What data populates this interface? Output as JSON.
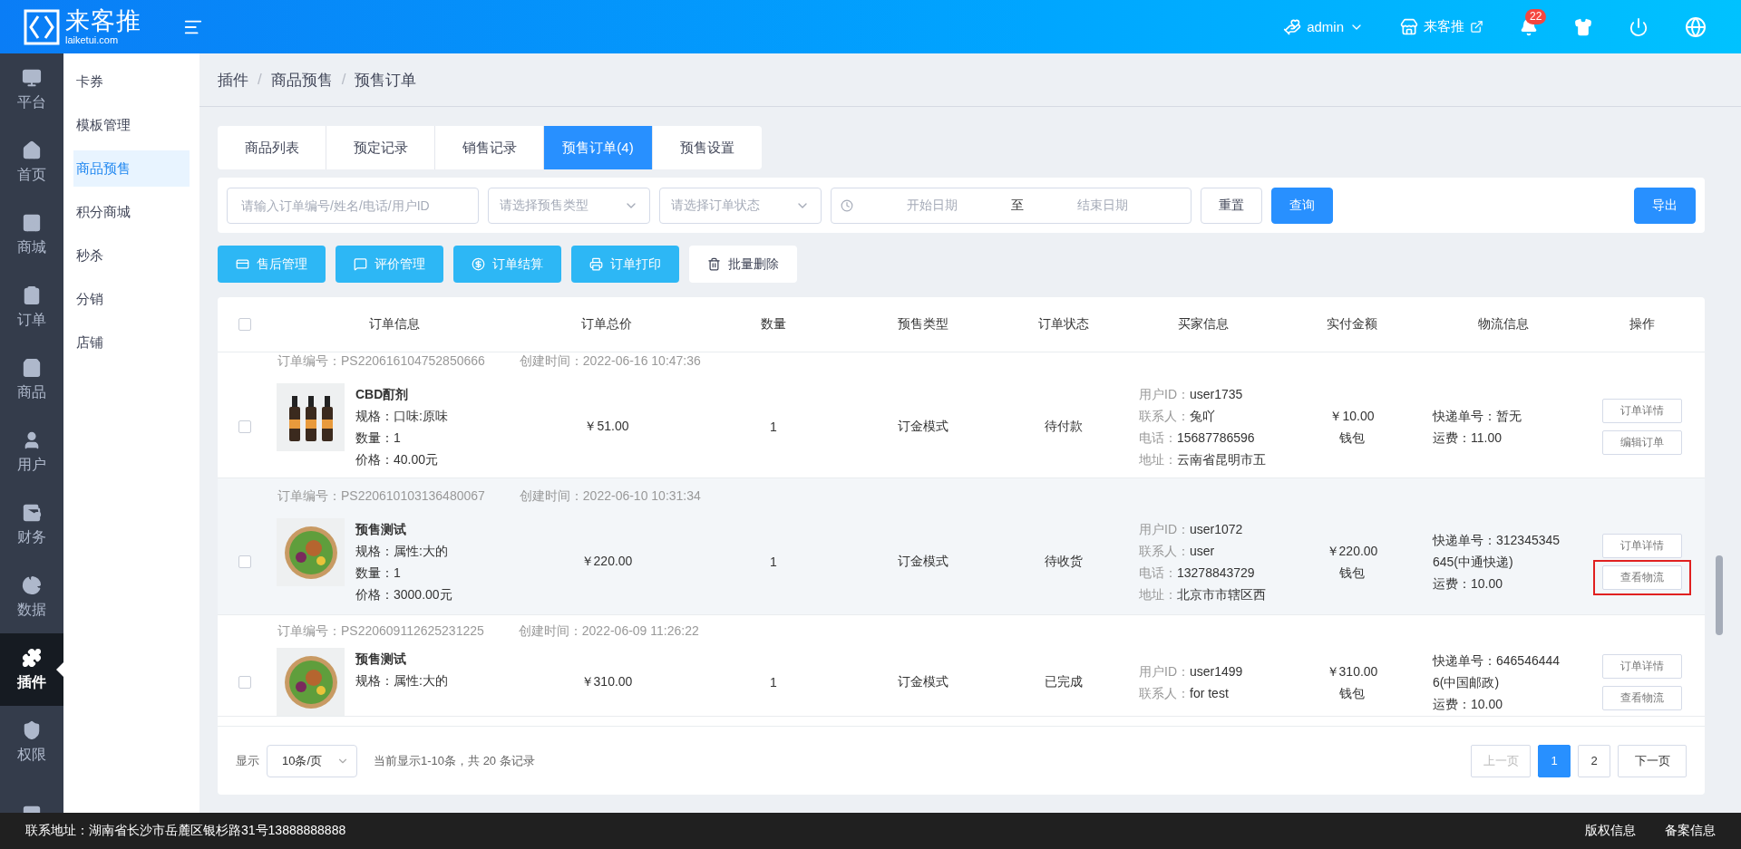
{
  "header": {
    "logo_title": "来客推",
    "logo_subtitle": "laiketui.com",
    "user": "admin",
    "store": "来客推",
    "notifications": "22"
  },
  "nav": [
    {
      "label": "平台",
      "selected": false
    },
    {
      "label": "首页",
      "selected": false
    },
    {
      "label": "商城",
      "selected": false
    },
    {
      "label": "订单",
      "selected": false
    },
    {
      "label": "商品",
      "selected": false
    },
    {
      "label": "用户",
      "selected": false
    },
    {
      "label": "财务",
      "selected": false
    },
    {
      "label": "数据",
      "selected": false
    },
    {
      "label": "插件",
      "selected": true
    },
    {
      "label": "权限",
      "selected": false
    },
    {
      "selected": false
    }
  ],
  "subnav": [
    {
      "label": "卡券",
      "selected": false
    },
    {
      "label": "模板管理",
      "selected": false
    },
    {
      "label": "商品预售",
      "selected": true
    },
    {
      "label": "积分商城",
      "selected": false
    },
    {
      "label": "秒杀",
      "selected": false
    },
    {
      "label": "分销",
      "selected": false
    },
    {
      "label": "店铺",
      "selected": false
    }
  ],
  "breadcrumb": [
    {
      "label": "插件"
    },
    {
      "separator": "/",
      "label": "商品预售"
    },
    {
      "separator": "/",
      "label": "预售订单"
    }
  ],
  "tabs": [
    {
      "label": "商品列表",
      "selected": false
    },
    {
      "label": "预定记录",
      "selected": false
    },
    {
      "label": "销售记录",
      "selected": false
    },
    {
      "label": "预售订单(4)",
      "selected": true
    },
    {
      "label": "预售设置",
      "selected": false
    }
  ],
  "filters": {
    "search_placeholder": "请输入订单编号/姓名/电话/用户ID",
    "type_placeholder": "请选择预售类型",
    "status_placeholder": "请选择订单状态",
    "start_placeholder": "开始日期",
    "range_separator": "至",
    "end_placeholder": "结束日期",
    "reset": "重置",
    "query": "查询",
    "export": "导出"
  },
  "actions": [
    {
      "label": "售后管理",
      "kind": "primary"
    },
    {
      "label": "评价管理",
      "kind": "primary"
    },
    {
      "label": "订单结算",
      "kind": "primary"
    },
    {
      "label": "订单打印",
      "kind": "primary"
    },
    {
      "label": "批量删除",
      "kind": "plain"
    }
  ],
  "table": {
    "checked": false,
    "columns": [
      "订单信息",
      "订单总价",
      "数量",
      "预售类型",
      "订单状态",
      "买家信息",
      "实付金额",
      "物流信息",
      "操作"
    ],
    "rows": [
      {
        "checked": false,
        "hovered": false,
        "order_no": "订单编号：PS220616104752850666",
        "created": "创建时间：2022-06-16 10:47:36",
        "product": "CBD酊剂",
        "details": [
          "规格：口味:原味",
          "数量：1",
          "价格：40.00元"
        ],
        "total": "￥51.00",
        "quantity": "1",
        "type": "订金模式",
        "status": "待付款",
        "buyer": [
          {
            "label": "用户ID：",
            "value": "user1735"
          },
          {
            "label": "联系人：",
            "value": "兔吖"
          },
          {
            "label": "电话：",
            "value": "15687786596"
          },
          {
            "label": "地址：",
            "value": "云南省昆明市五"
          }
        ],
        "paid": "￥10.00",
        "pay_method": "钱包",
        "logistics": [
          "快递单号：暂无",
          "运费：11.00"
        ],
        "ops": [
          {
            "label": "订单详情",
            "highlighted": false
          },
          {
            "label": "编辑订单",
            "highlighted": false
          }
        ]
      },
      {
        "checked": false,
        "hovered": true,
        "order_no": "订单编号：PS220610103136480067",
        "created": "创建时间：2022-06-10 10:31:34",
        "product": "预售测试",
        "details": [
          "规格：属性:大的",
          "数量：1",
          "价格：3000.00元"
        ],
        "total": "￥220.00",
        "quantity": "1",
        "type": "订金模式",
        "status": "待收货",
        "buyer": [
          {
            "label": "用户ID：",
            "value": "user1072"
          },
          {
            "label": "联系人：",
            "value": "user"
          },
          {
            "label": "电话：",
            "value": "13278843729"
          },
          {
            "label": "地址：",
            "value": "北京市市辖区西"
          }
        ],
        "paid": "￥220.00",
        "pay_method": "钱包",
        "logistics": [
          "快递单号：312345345645(中通快递)",
          "运费：10.00"
        ],
        "ops": [
          {
            "label": "订单详情",
            "highlighted": false
          },
          {
            "label": "查看物流",
            "highlighted": true
          }
        ]
      },
      {
        "checked": false,
        "hovered": false,
        "order_no": "订单编号：PS220609112625231225",
        "created": "创建时间：2022-06-09 11:26:22",
        "product": "预售测试",
        "details": [
          "规格：属性:大的"
        ],
        "total": "￥310.00",
        "quantity": "1",
        "type": "订金模式",
        "status": "已完成",
        "buyer": [
          {
            "label": "用户ID：",
            "value": "user1499"
          },
          {
            "label": "联系人：",
            "value": "for test"
          }
        ],
        "paid": "￥310.00",
        "pay_method": "钱包",
        "logistics": [
          "快递单号：6465464446(中国邮政)",
          "运费：10.00"
        ],
        "ops": [
          {
            "label": "订单详情",
            "highlighted": false
          },
          {
            "label": "查看物流",
            "highlighted": false
          }
        ]
      }
    ]
  },
  "pagination": {
    "show_label": "显示",
    "page_size": "10条/页",
    "summary": "当前显示1-10条，共 20 条记录",
    "prev": "上一页",
    "prev_disabled": true,
    "pages": [
      {
        "label": "1",
        "selected": true
      },
      {
        "label": "2",
        "selected": false
      }
    ],
    "next": "下一页",
    "next_disabled": false
  },
  "footer": {
    "address": "联系地址：湖南省长沙市岳麓区银杉路31号13888888888",
    "links": [
      "版权信息",
      "备案信息"
    ]
  }
}
